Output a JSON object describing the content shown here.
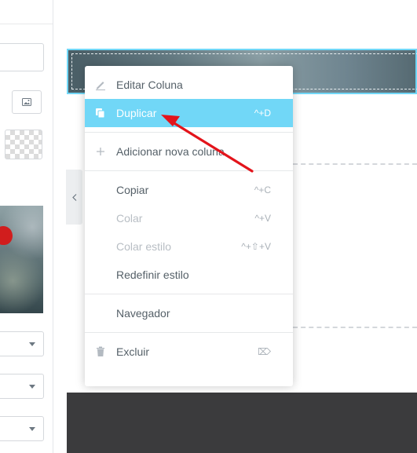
{
  "context_menu": {
    "edit_column": "Editar Coluna",
    "duplicate": "Duplicar",
    "duplicate_shortcut": "^+D",
    "add_column": "Adicionar nova coluna",
    "copy": "Copiar",
    "copy_shortcut": "^+C",
    "paste": "Colar",
    "paste_shortcut": "^+V",
    "paste_style": "Colar estilo",
    "paste_style_shortcut": "^+⇧+V",
    "reset_style": "Redefinir estilo",
    "navigator": "Navegador",
    "delete": "Excluir",
    "delete_shortcut": "⌦"
  },
  "icons": {
    "edit": "pencil-icon",
    "duplicate": "copy-icon",
    "add": "plus-icon",
    "delete": "trash-icon",
    "delete_key": "delete-key-icon",
    "media": "image-icon",
    "collapse": "chevron-left-icon",
    "annotation": "red-arrow"
  },
  "colors": {
    "accent": "#71d7f7",
    "menu_text": "#556068",
    "disabled_text": "#b8bec4",
    "annotation": "#e3141b",
    "footer": "#3b3b3d"
  }
}
